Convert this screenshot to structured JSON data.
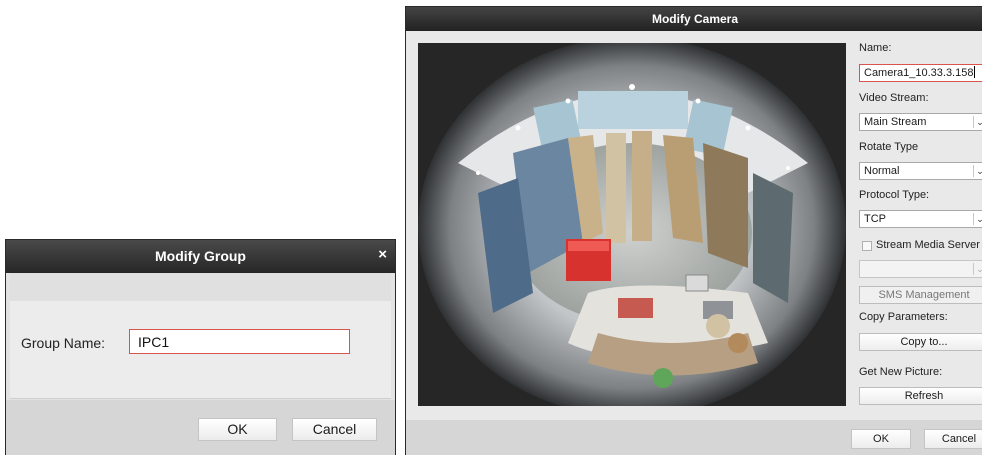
{
  "group_dialog": {
    "title": "Modify Group",
    "close_symbol": "×",
    "group_name_label": "Group Name:",
    "group_name_value": "IPC1",
    "ok_label": "OK",
    "cancel_label": "Cancel"
  },
  "camera_dialog": {
    "title": "Modify Camera",
    "preview_image": "fisheye-store-camera-view",
    "name_label": "Name:",
    "name_value": "Camera1_10.33.3.158",
    "video_stream_label": "Video Stream:",
    "video_stream_value": "Main Stream",
    "rotate_type_label": "Rotate Type",
    "rotate_type_value": "Normal",
    "protocol_type_label": "Protocol Type:",
    "protocol_type_value": "TCP",
    "stream_media_server_label": "Stream Media Server",
    "stream_media_server_checked": false,
    "stream_media_server_value": "",
    "sms_management_label": "SMS Management",
    "copy_parameters_label": "Copy Parameters:",
    "copy_to_label": "Copy to...",
    "get_new_picture_label": "Get New Picture:",
    "refresh_label": "Refresh",
    "ok_label": "OK",
    "cancel_label": "Cancel"
  },
  "colors": {
    "titlebar": "#2f2f2f",
    "active_border": "#d9534f",
    "dialog_bg": "#e3e3e3"
  }
}
